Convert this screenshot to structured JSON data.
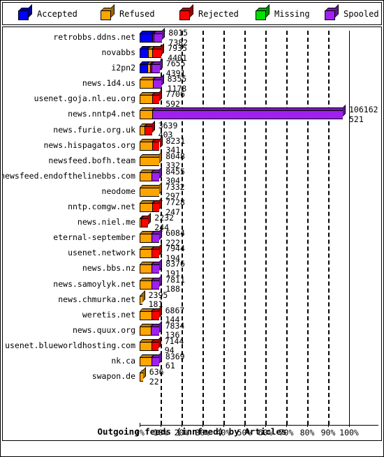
{
  "legend": {
    "items": [
      {
        "label": "Accepted",
        "color": "#0000ff",
        "icon": "cube-icon"
      },
      {
        "label": "Refused",
        "color": "#ffa500",
        "icon": "cube-icon"
      },
      {
        "label": "Rejected",
        "color": "#ff0000",
        "icon": "cube-icon"
      },
      {
        "label": "Missing",
        "color": "#00e000",
        "icon": "cube-icon"
      },
      {
        "label": "Spooled",
        "color": "#a020f0",
        "icon": "cube-icon"
      }
    ]
  },
  "chart_data": {
    "type": "bar",
    "orientation": "horizontal",
    "stacked": true,
    "normalized_percent": true,
    "title": "Outgoing feeds (innfeed) by Articles",
    "xlabel": "",
    "ylabel": "",
    "xlim": [
      0,
      100
    ],
    "grid": true,
    "legend_position": "top",
    "xticks": [
      "0%",
      "10%",
      "20%",
      "30%",
      "40%",
      "50%",
      "60%",
      "70%",
      "80%",
      "90%",
      "100%"
    ],
    "series_names": [
      "Accepted",
      "Refused",
      "Rejected",
      "Missing",
      "Spooled"
    ],
    "categories": [
      "retrobbs.ddns.net",
      "novabbs",
      "i2pn2",
      "news.1d4.us",
      "usenet.goja.nl.eu.org",
      "news.nntp4.net",
      "news.furie.org.uk",
      "news.hispagatos.org",
      "newsfeed.bofh.team",
      "newsfeed.endofthelinebbs.com",
      "neodome",
      "nntp.comgw.net",
      "news.niel.me",
      "eternal-september",
      "usenet.network",
      "news.bbs.nz",
      "news.samoylyk.net",
      "news.chmurka.net",
      "weretis.net",
      "news.quux.org",
      "usenet.blueworldhosting.com",
      "nk.ca",
      "swapon.de"
    ],
    "rows": [
      {
        "category": "retrobbs.ddns.net",
        "value_top": "8015",
        "value_bottom": "7382",
        "segments": [
          {
            "name": "Accepted",
            "percent": 6.0
          },
          {
            "name": "Rejected",
            "percent": 0.6
          },
          {
            "name": "Spooled",
            "percent": 4.2
          }
        ]
      },
      {
        "category": "novabbs",
        "value_top": "7935",
        "value_bottom": "4401",
        "segments": [
          {
            "name": "Accepted",
            "percent": 4.0
          },
          {
            "name": "Refused",
            "percent": 2.0
          },
          {
            "name": "Rejected",
            "percent": 4.4
          }
        ]
      },
      {
        "category": "i2pn2",
        "value_top": "7655",
        "value_bottom": "4391",
        "segments": [
          {
            "name": "Accepted",
            "percent": 3.6
          },
          {
            "name": "Refused",
            "percent": 1.3
          },
          {
            "name": "Rejected",
            "percent": 0.7
          },
          {
            "name": "Spooled",
            "percent": 4.0
          }
        ]
      },
      {
        "category": "news.1d4.us",
        "value_top": "8355",
        "value_bottom": "1178",
        "segments": [
          {
            "name": "Refused",
            "percent": 6.2
          },
          {
            "name": "Spooled",
            "percent": 4.0
          }
        ]
      },
      {
        "category": "usenet.goja.nl.eu.org",
        "value_top": "7706",
        "value_bottom": "592",
        "segments": [
          {
            "name": "Refused",
            "percent": 6.0
          },
          {
            "name": "Rejected",
            "percent": 3.4
          }
        ]
      },
      {
        "category": "news.nntp4.net",
        "value_top": "106162",
        "value_bottom": "521",
        "segments": [
          {
            "name": "Refused",
            "percent": 6.0
          },
          {
            "name": "Spooled",
            "percent": 91.0
          }
        ]
      },
      {
        "category": "news.furie.org.uk",
        "value_top": "3639",
        "value_bottom": "403",
        "segments": [
          {
            "name": "Refused",
            "percent": 2.2
          },
          {
            "name": "Rejected",
            "percent": 3.7
          }
        ]
      },
      {
        "category": "news.hispagatos.org",
        "value_top": "8231",
        "value_bottom": "341",
        "segments": [
          {
            "name": "Refused",
            "percent": 5.9
          },
          {
            "name": "Rejected",
            "percent": 3.6
          }
        ]
      },
      {
        "category": "newsfeed.bofh.team",
        "value_top": "8048",
        "value_bottom": "332",
        "segments": [
          {
            "name": "Refused",
            "percent": 9.4
          }
        ]
      },
      {
        "category": "newsfeed.endofthelinebbs.com",
        "value_top": "8455",
        "value_bottom": "304",
        "segments": [
          {
            "name": "Refused",
            "percent": 5.6
          },
          {
            "name": "Spooled",
            "percent": 3.8
          }
        ]
      },
      {
        "category": "neodome",
        "value_top": "7332",
        "value_bottom": "297",
        "segments": [
          {
            "name": "Refused",
            "percent": 9.3
          }
        ]
      },
      {
        "category": "nntp.comgw.net",
        "value_top": "7728",
        "value_bottom": "247",
        "segments": [
          {
            "name": "Refused",
            "percent": 5.9
          },
          {
            "name": "Rejected",
            "percent": 3.5
          }
        ]
      },
      {
        "category": "news.niel.me",
        "value_top": "2232",
        "value_bottom": "244",
        "segments": [
          {
            "name": "Refused",
            "percent": 0.8
          },
          {
            "name": "Rejected",
            "percent": 3.3
          }
        ]
      },
      {
        "category": "eternal-september",
        "value_top": "6084",
        "value_bottom": "222",
        "segments": [
          {
            "name": "Refused",
            "percent": 5.5
          },
          {
            "name": "Spooled",
            "percent": 3.9
          }
        ]
      },
      {
        "category": "usenet.network",
        "value_top": "7944",
        "value_bottom": "194",
        "segments": [
          {
            "name": "Refused",
            "percent": 5.7
          },
          {
            "name": "Rejected",
            "percent": 3.7
          }
        ]
      },
      {
        "category": "news.bbs.nz",
        "value_top": "8376",
        "value_bottom": "191",
        "segments": [
          {
            "name": "Refused",
            "percent": 5.7
          },
          {
            "name": "Spooled",
            "percent": 3.7
          }
        ]
      },
      {
        "category": "news.samoylyk.net",
        "value_top": "7811",
        "value_bottom": "188",
        "segments": [
          {
            "name": "Refused",
            "percent": 5.7
          },
          {
            "name": "Spooled",
            "percent": 3.7
          }
        ]
      },
      {
        "category": "news.chmurka.net",
        "value_top": "2395",
        "value_bottom": "181",
        "segments": [
          {
            "name": "Refused",
            "percent": 1.2
          },
          {
            "name": "Rejected",
            "percent": 0.0
          },
          {
            "name": "Spooled",
            "percent": 0.0
          }
        ]
      },
      {
        "category": "weretis.net",
        "value_top": "6867",
        "value_bottom": "144",
        "segments": [
          {
            "name": "Refused",
            "percent": 5.5
          },
          {
            "name": "Rejected",
            "percent": 3.7
          }
        ]
      },
      {
        "category": "news.quux.org",
        "value_top": "7834",
        "value_bottom": "136",
        "segments": [
          {
            "name": "Refused",
            "percent": 5.4
          },
          {
            "name": "Spooled",
            "percent": 3.8
          }
        ]
      },
      {
        "category": "usenet.blueworldhosting.com",
        "value_top": "7144",
        "value_bottom": "94",
        "segments": [
          {
            "name": "Refused",
            "percent": 5.6
          },
          {
            "name": "Rejected",
            "percent": 3.3
          }
        ]
      },
      {
        "category": "nk.ca",
        "value_top": "8369",
        "value_bottom": "61",
        "segments": [
          {
            "name": "Refused",
            "percent": 5.6
          },
          {
            "name": "Spooled",
            "percent": 3.7
          }
        ]
      },
      {
        "category": "swapon.de",
        "value_top": "636",
        "value_bottom": "22",
        "segments": [
          {
            "name": "Refused",
            "percent": 1.6
          }
        ]
      }
    ]
  }
}
